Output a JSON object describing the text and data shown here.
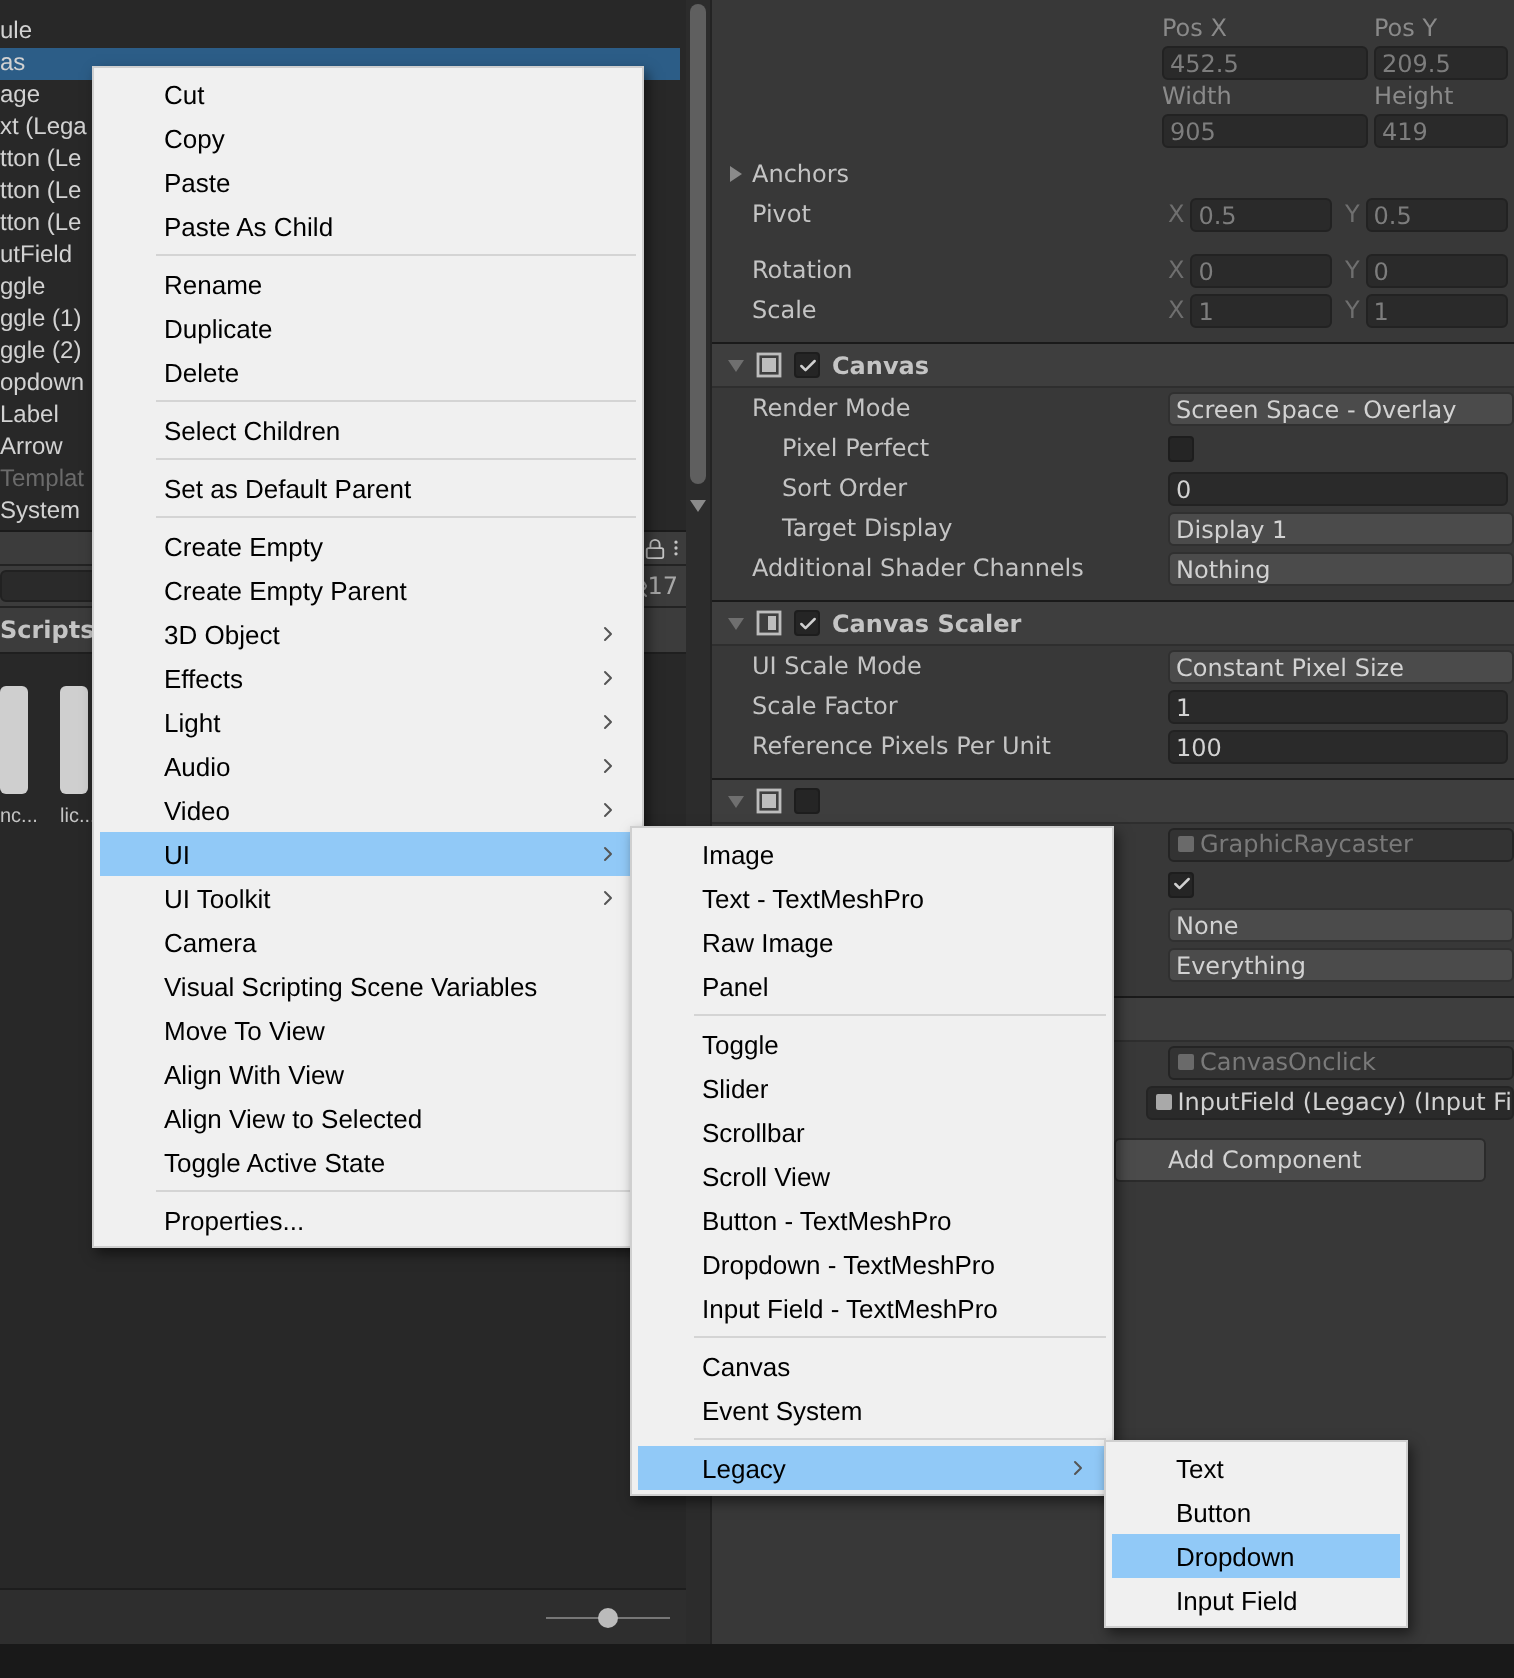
{
  "hierarchy": {
    "items": [
      {
        "label": "ule",
        "selected": false,
        "disabled": false
      },
      {
        "label": "as",
        "selected": true,
        "disabled": false
      },
      {
        "label": "age",
        "selected": false,
        "disabled": false
      },
      {
        "label": "xt (Lega",
        "selected": false,
        "disabled": false
      },
      {
        "label": "tton (Le",
        "selected": false,
        "disabled": false
      },
      {
        "label": "tton (Le",
        "selected": false,
        "disabled": false
      },
      {
        "label": "tton (Le",
        "selected": false,
        "disabled": false
      },
      {
        "label": "utField",
        "selected": false,
        "disabled": false
      },
      {
        "label": "ggle",
        "selected": false,
        "disabled": false
      },
      {
        "label": "ggle (1)",
        "selected": false,
        "disabled": false
      },
      {
        "label": "ggle (2)",
        "selected": false,
        "disabled": false
      },
      {
        "label": "opdown",
        "selected": false,
        "disabled": false
      },
      {
        "label": "Label",
        "selected": false,
        "disabled": false
      },
      {
        "label": "Arrow",
        "selected": false,
        "disabled": false
      },
      {
        "label": "Templat",
        "selected": false,
        "disabled": true
      },
      {
        "label": "System",
        "selected": false,
        "disabled": false
      }
    ]
  },
  "project": {
    "hidden_count": "17",
    "folder": "Scripts",
    "assets": [
      {
        "label": "nc..."
      },
      {
        "label": "lic..."
      }
    ],
    "zoom": {
      "level": 0.5
    }
  },
  "inspector": {
    "rect_transform": {
      "fields": [
        {
          "label": "Pos X",
          "value": "452.5"
        },
        {
          "label": "Pos Y",
          "value": "209.5"
        },
        {
          "label": "Width",
          "value": "905"
        },
        {
          "label": "Height",
          "value": "419"
        }
      ],
      "anchors": {
        "label": "Anchors",
        "expanded": false
      },
      "vectors": [
        {
          "label": "Pivot",
          "axes": [
            {
              "axis": "X",
              "value": "0.5"
            },
            {
              "axis": "Y",
              "value": "0.5"
            }
          ]
        },
        {
          "label": "Rotation",
          "axes": [
            {
              "axis": "X",
              "value": "0"
            },
            {
              "axis": "Y",
              "value": "0"
            }
          ]
        },
        {
          "label": "Scale",
          "axes": [
            {
              "axis": "X",
              "value": "1"
            },
            {
              "axis": "Y",
              "value": "1"
            }
          ]
        }
      ]
    },
    "components": [
      {
        "title": "Canvas",
        "enabled": true,
        "properties": [
          {
            "label": "Render Mode",
            "kind": "dropdown",
            "value": "Screen Space - Overlay",
            "indented": false,
            "disabled": false
          },
          {
            "label": "Pixel Perfect",
            "kind": "checkbox",
            "checked": false,
            "indented": true,
            "disabled": false
          },
          {
            "label": "Sort Order",
            "kind": "number",
            "value": "0",
            "indented": true,
            "disabled": false
          },
          {
            "label": "Target Display",
            "kind": "dropdown",
            "value": "Display 1",
            "indented": true,
            "disabled": false
          },
          {
            "label": "Additional Shader Channels",
            "kind": "dropdown",
            "value": "Nothing",
            "indented": false,
            "disabled": false
          }
        ]
      },
      {
        "title": "Canvas Scaler",
        "enabled": true,
        "properties": [
          {
            "label": "UI Scale Mode",
            "kind": "dropdown",
            "value": "Constant Pixel Size",
            "indented": false,
            "disabled": false
          },
          {
            "label": "Scale Factor",
            "kind": "number",
            "value": "1",
            "indented": false,
            "disabled": false
          },
          {
            "label": "Reference Pixels Per Unit",
            "kind": "number",
            "value": "100",
            "indented": false,
            "disabled": false
          }
        ]
      },
      {
        "enabled": false,
        "properties": [
          {
            "kind": "object",
            "value": "GraphicRaycaster",
            "disabled": true
          },
          {
            "kind": "checkbox",
            "checked": true,
            "disabled": false
          },
          {
            "kind": "dropdown",
            "value": "None",
            "disabled": false
          },
          {
            "kind": "dropdown",
            "value": "Everything",
            "disabled": false
          }
        ]
      },
      {
        "properties": [
          {
            "kind": "object",
            "value": "CanvasOnclick",
            "disabled": true
          },
          {
            "kind": "object",
            "value": "InputField (Legacy) (Input Fi",
            "disabled": false
          }
        ]
      }
    ],
    "add_button": "Add Component"
  },
  "menus": [
    {
      "groups": [
        [
          {
            "label": "Cut",
            "kind": "action",
            "selected": false
          },
          {
            "label": "Copy",
            "kind": "action",
            "selected": false
          },
          {
            "label": "Paste",
            "kind": "action",
            "selected": false
          },
          {
            "label": "Paste As Child",
            "kind": "action",
            "selected": false
          }
        ],
        [
          {
            "label": "Rename",
            "kind": "action",
            "selected": false
          },
          {
            "label": "Duplicate",
            "kind": "action",
            "selected": false
          },
          {
            "label": "Delete",
            "kind": "action",
            "selected": false
          }
        ],
        [
          {
            "label": "Select Children",
            "kind": "action",
            "selected": false
          }
        ],
        [
          {
            "label": "Set as Default Parent",
            "kind": "action",
            "selected": false
          }
        ],
        [
          {
            "label": "Create Empty",
            "kind": "action",
            "selected": false
          },
          {
            "label": "Create Empty Parent",
            "kind": "action",
            "selected": false
          },
          {
            "label": "3D Object",
            "kind": "submenu",
            "selected": false
          },
          {
            "label": "Effects",
            "kind": "submenu",
            "selected": false
          },
          {
            "label": "Light",
            "kind": "submenu",
            "selected": false
          },
          {
            "label": "Audio",
            "kind": "submenu",
            "selected": false
          },
          {
            "label": "Video",
            "kind": "submenu",
            "selected": false
          },
          {
            "label": "UI",
            "kind": "submenu",
            "selected": true
          },
          {
            "label": "UI Toolkit",
            "kind": "submenu",
            "selected": false
          },
          {
            "label": "Camera",
            "kind": "action",
            "selected": false
          },
          {
            "label": "Visual Scripting Scene Variables",
            "kind": "action",
            "selected": false
          },
          {
            "label": "Move To View",
            "kind": "action",
            "selected": false
          },
          {
            "label": "Align With View",
            "kind": "action",
            "selected": false
          },
          {
            "label": "Align View to Selected",
            "kind": "action",
            "selected": false
          },
          {
            "label": "Toggle Active State",
            "kind": "action",
            "selected": false
          }
        ],
        [
          {
            "label": "Properties...",
            "kind": "action",
            "selected": false
          }
        ]
      ]
    },
    {
      "groups": [
        [
          {
            "label": "Image",
            "kind": "action",
            "selected": false
          },
          {
            "label": "Text - TextMeshPro",
            "kind": "action",
            "selected": false
          },
          {
            "label": "Raw Image",
            "kind": "action",
            "selected": false
          },
          {
            "label": "Panel",
            "kind": "action",
            "selected": false
          }
        ],
        [
          {
            "label": "Toggle",
            "kind": "action",
            "selected": false
          },
          {
            "label": "Slider",
            "kind": "action",
            "selected": false
          },
          {
            "label": "Scrollbar",
            "kind": "action",
            "selected": false
          },
          {
            "label": "Scroll View",
            "kind": "action",
            "selected": false
          },
          {
            "label": "Button - TextMeshPro",
            "kind": "action",
            "selected": false
          },
          {
            "label": "Dropdown - TextMeshPro",
            "kind": "action",
            "selected": false
          },
          {
            "label": "Input Field - TextMeshPro",
            "kind": "action",
            "selected": false
          }
        ],
        [
          {
            "label": "Canvas",
            "kind": "action",
            "selected": false
          },
          {
            "label": "Event System",
            "kind": "action",
            "selected": false
          }
        ],
        [
          {
            "label": "Legacy",
            "kind": "submenu",
            "selected": true
          }
        ]
      ]
    },
    {
      "groups": [
        [
          {
            "label": "Text",
            "kind": "action",
            "selected": false
          },
          {
            "label": "Button",
            "kind": "action",
            "selected": false
          },
          {
            "label": "Dropdown",
            "kind": "action",
            "selected": true
          },
          {
            "label": "Input Field",
            "kind": "action",
            "selected": false
          }
        ]
      ]
    }
  ]
}
